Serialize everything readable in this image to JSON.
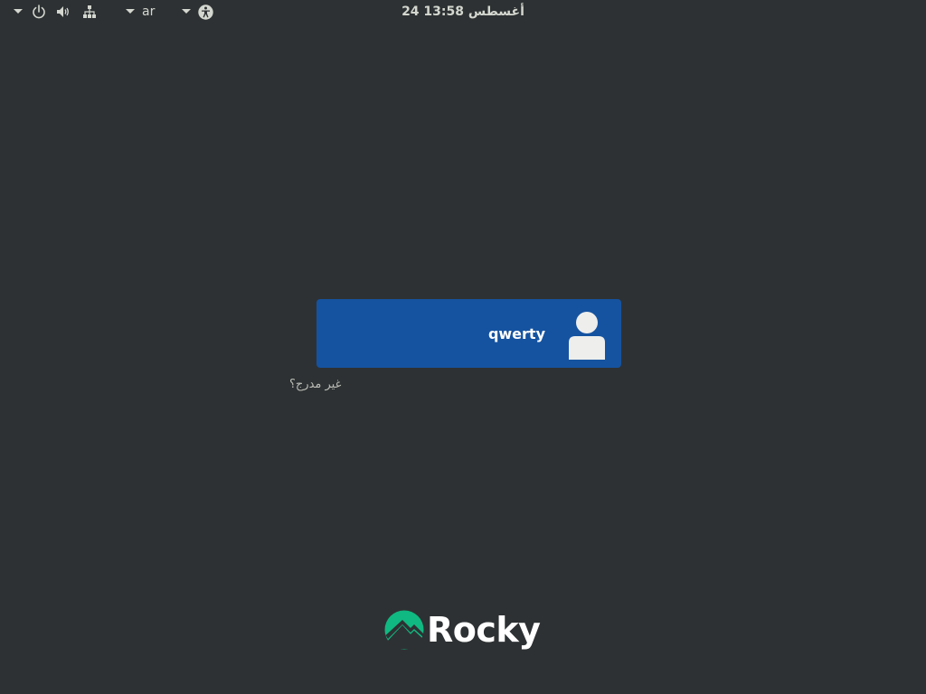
{
  "topbar": {
    "clock": "24 أغسطس 13:58",
    "keyboard_layout": "ar",
    "icons": {
      "system_menu_arrow": "chevron-down-icon",
      "power": "power-icon",
      "volume": "volume-icon",
      "network": "network-icon",
      "keyboard_arrow": "chevron-down-icon",
      "accessibility_arrow": "chevron-down-icon",
      "accessibility": "accessibility-icon"
    },
    "text_color": "#d3d7cf"
  },
  "login": {
    "users": [
      {
        "name": "qwerty",
        "avatar_icon": "user-avatar-icon"
      }
    ],
    "not_listed_label": "غير مدرج؟",
    "card_color": "#1553a0"
  },
  "branding": {
    "logo_text": "Rocky",
    "logo_color": "#10b981"
  },
  "background_color": "#2e3133"
}
